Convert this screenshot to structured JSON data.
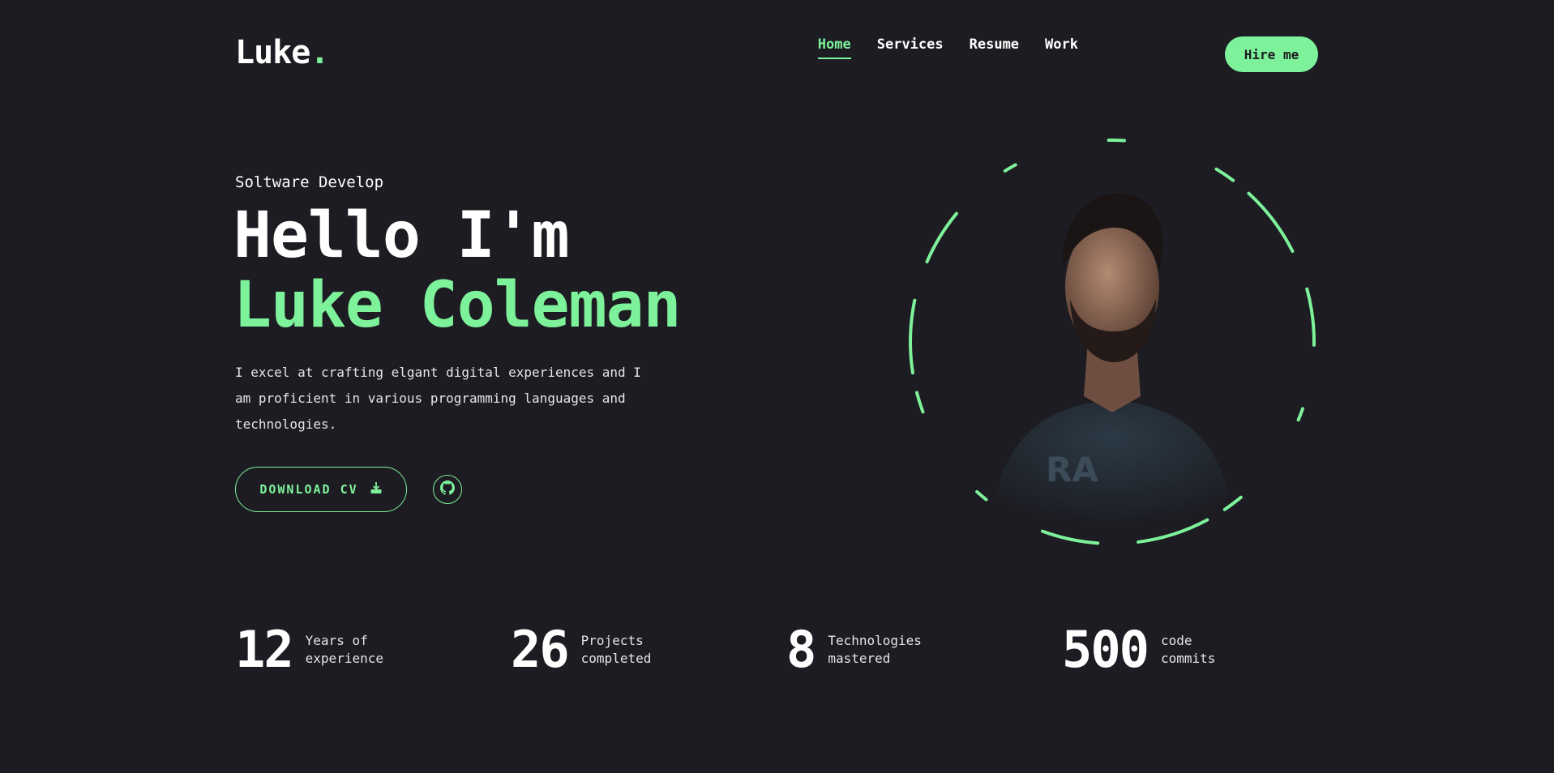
{
  "header": {
    "logo_text": "Luke",
    "logo_dot": ".",
    "nav": [
      {
        "label": "Home",
        "active": true
      },
      {
        "label": "Services",
        "active": false
      },
      {
        "label": "Resume",
        "active": false
      },
      {
        "label": "Work",
        "active": false
      }
    ],
    "hire_label": "Hire me"
  },
  "hero": {
    "subtitle": "Soltware Develop",
    "greeting": "Hello I'm",
    "name": "Luke Coleman",
    "description": "I excel at crafting elgant digital experiences and I am proficient in various programming languages and technologies.",
    "download_label": "DOWNLOAD CV",
    "download_icon": "download-icon",
    "github_icon": "github-icon"
  },
  "stats": [
    {
      "value": "12",
      "label": "Years of experience"
    },
    {
      "value": "26",
      "label": "Projects completed"
    },
    {
      "value": "8",
      "label": "Technologies mastered"
    },
    {
      "value": "500",
      "label": "code commits"
    }
  ],
  "colors": {
    "background": "#1c1c22",
    "accent": "#7ef29a",
    "text": "#ffffff"
  }
}
